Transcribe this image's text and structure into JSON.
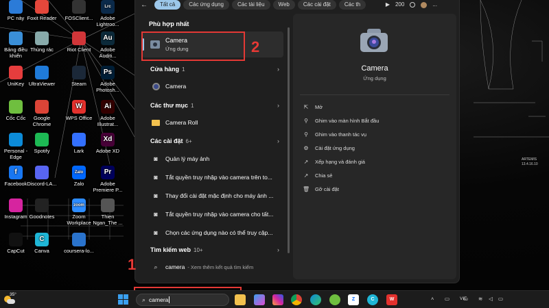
{
  "desktop_icons": [
    {
      "label": "PC này",
      "icon": "pc-icon"
    },
    {
      "label": "Foxit Reader",
      "icon": "foxit-icon"
    },
    {
      "label": "FOSClient...",
      "icon": "fosclient-icon"
    },
    {
      "label": "Adobe Lightroo...",
      "icon": "lightroom-icon"
    },
    {
      "label": "Bảng điều khiển",
      "icon": "control-panel-icon"
    },
    {
      "label": "Thùng rác",
      "icon": "recycle-bin-icon"
    },
    {
      "label": "Riot Client",
      "icon": "riot-icon"
    },
    {
      "label": "Adobe Auditi...",
      "icon": "audition-icon"
    },
    {
      "label": "UniKey",
      "icon": "unikey-icon"
    },
    {
      "label": "UltraViewer",
      "icon": "ultraviewer-icon"
    },
    {
      "label": "Steam",
      "icon": "steam-icon"
    },
    {
      "label": "Adobe Photosh...",
      "icon": "photoshop-icon"
    },
    {
      "label": "Cốc Cốc",
      "icon": "coccoc-icon"
    },
    {
      "label": "Google Chrome",
      "icon": "chrome-icon"
    },
    {
      "label": "WPS Office",
      "icon": "wps-icon"
    },
    {
      "label": "Adobe Illustrat...",
      "icon": "illustrator-icon"
    },
    {
      "label": "Personal - Edge",
      "icon": "edge-icon"
    },
    {
      "label": "Spotify",
      "icon": "spotify-icon"
    },
    {
      "label": "Lark",
      "icon": "lark-icon"
    },
    {
      "label": "Adobe XD",
      "icon": "xd-icon"
    },
    {
      "label": "Facebook",
      "icon": "facebook-icon"
    },
    {
      "label": "Discord-LA...",
      "icon": "discord-icon"
    },
    {
      "label": "Zalo",
      "icon": "zalo-icon"
    },
    {
      "label": "Adobe Premiere P...",
      "icon": "premiere-icon"
    },
    {
      "label": "Instagram",
      "icon": "instagram-icon"
    },
    {
      "label": "Goodnotes",
      "icon": "goodnotes-icon"
    },
    {
      "label": "Zoom Workplace",
      "icon": "zoom-icon"
    },
    {
      "label": "Thien Ngan_The ...",
      "icon": "game-icon"
    },
    {
      "label": "CapCut",
      "icon": "capcut-icon"
    },
    {
      "label": "Canva",
      "icon": "canva-icon"
    },
    {
      "label": "coursera-lo...",
      "icon": "coursera-icon"
    }
  ],
  "wallpaper_text": {
    "line1": "ARTEMIS",
    "line2": "13.4.16.10"
  },
  "filters": {
    "chips": [
      "Tất cả",
      "Các ứng dụng",
      "Các tài liệu",
      "Web",
      "Các cài đặt",
      "Các th"
    ],
    "more": "▶",
    "count": "200",
    "more_menu": "..."
  },
  "left": {
    "best_match_title": "Phù hợp nhất",
    "best_match": {
      "name": "Camera",
      "type": "Ứng dụng"
    },
    "store": {
      "title": "Cửa hàng",
      "count": "1",
      "item": "Camera"
    },
    "folders": {
      "title": "Các thư mục",
      "count": "1",
      "item": "Camera Roll"
    },
    "settings": {
      "title": "Các cài đặt",
      "count": "6+",
      "items": [
        "Quản lý máy ảnh",
        "Tắt quyền truy nhập vào camera trên to...",
        "Thay đổi cài đặt mặc định cho máy ảnh ...",
        "Tắt quyền truy nhập vào camera cho tất...",
        "Chọn các ứng dụng nào có thể truy cập..."
      ]
    },
    "web": {
      "title": "Tìm kiếm web",
      "count": "10+",
      "query": "camera",
      "hint": "- Xem thêm kết quả tìm kiếm"
    }
  },
  "right": {
    "app_name": "Camera",
    "app_type": "Ứng dụng",
    "actions": [
      {
        "label": "Mở",
        "icon": "open-icon"
      },
      {
        "label": "Ghim vào màn hình Bắt đầu",
        "icon": "pin-icon"
      },
      {
        "label": "Ghim vào thanh tác vụ",
        "icon": "pin-icon"
      },
      {
        "label": "Cài đặt ứng dụng",
        "icon": "gear-icon"
      },
      {
        "label": "Xếp hạng và đánh giá",
        "icon": "share-icon"
      },
      {
        "label": "Chia sẻ",
        "icon": "share-icon"
      },
      {
        "label": "Gỡ cài đặt",
        "icon": "trash-icon"
      }
    ]
  },
  "annotations": {
    "one": "1",
    "two": "2"
  },
  "taskbar": {
    "weather": "35°",
    "search_value": "camera",
    "language": "VIE"
  }
}
